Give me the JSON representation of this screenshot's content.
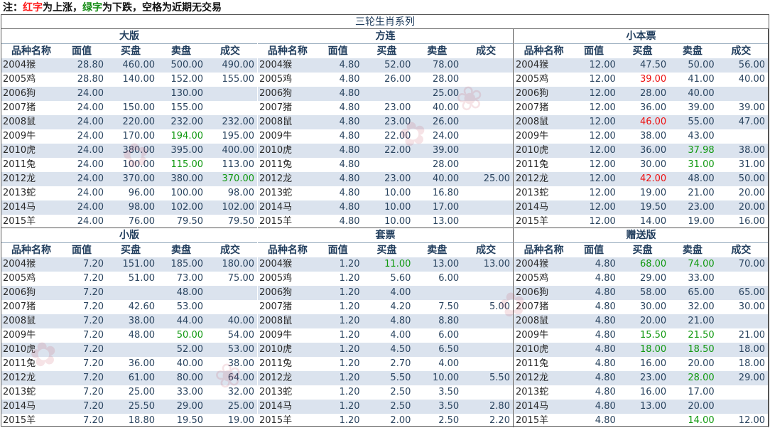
{
  "note": {
    "prefix": "注：",
    "red_label": "红字",
    "mid1": "为上涨，",
    "green_label": "绿字",
    "mid2": "为下跌，空格为近期无交易"
  },
  "main_title": "三轮生肖系列",
  "colors": {
    "up": "#ee1111",
    "down": "#119911",
    "header": "#1f3c5c",
    "row_alt": "#dbe3ee"
  },
  "columns": [
    "品种名称",
    "面值",
    "买盘",
    "卖盘",
    "成交"
  ],
  "panels": [
    {
      "title": "大版",
      "rows": [
        [
          "2004猴",
          "28.80",
          "460.00",
          "500.00",
          "490.00"
        ],
        [
          "2005鸡",
          "28.80",
          "140.00",
          "152.00",
          "155.00"
        ],
        [
          "2006狗",
          "24.00",
          "",
          "130.00",
          ""
        ],
        [
          "2007猪",
          "24.00",
          "150.00",
          "155.00",
          ""
        ],
        [
          "2008鼠",
          "24.00",
          "220.00",
          "232.00",
          "232.00"
        ],
        [
          "2009牛",
          "24.00",
          "170.00",
          "194.00",
          "195.00"
        ],
        [
          "2010虎",
          "24.00",
          "380.00",
          "395.00",
          "400.00"
        ],
        [
          "2011兔",
          "24.00",
          "100.00",
          "115.00",
          "113.00"
        ],
        [
          "2012龙",
          "24.00",
          "370.00",
          "380.00",
          "370.00"
        ],
        [
          "2013蛇",
          "24.00",
          "96.00",
          "100.00",
          "98.00"
        ],
        [
          "2014马",
          "24.00",
          "98.00",
          "102.00",
          "102.00"
        ],
        [
          "2015羊",
          "24.00",
          "76.00",
          "79.50",
          "79.50"
        ]
      ],
      "colors": [
        [
          5,
          3,
          "down"
        ],
        [
          7,
          3,
          "down"
        ],
        [
          8,
          4,
          "down"
        ]
      ]
    },
    {
      "title": "方连",
      "rows": [
        [
          "2004猴",
          "4.80",
          "52.00",
          "78.00",
          ""
        ],
        [
          "2005鸡",
          "4.80",
          "26.00",
          "28.00",
          ""
        ],
        [
          "2006狗",
          "4.80",
          "",
          "25.00",
          ""
        ],
        [
          "2007猪",
          "4.80",
          "23.00",
          "40.00",
          ""
        ],
        [
          "2008鼠",
          "4.80",
          "23.00",
          "26.00",
          ""
        ],
        [
          "2009牛",
          "4.80",
          "22.00",
          "24.00",
          ""
        ],
        [
          "2010虎",
          "4.80",
          "22.00",
          "39.00",
          ""
        ],
        [
          "2011兔",
          "4.80",
          "",
          "28.00",
          ""
        ],
        [
          "2012龙",
          "4.80",
          "23.00",
          "40.00",
          "25.00"
        ],
        [
          "2013蛇",
          "4.80",
          "10.00",
          "16.80",
          ""
        ],
        [
          "2014马",
          "4.80",
          "10.00",
          "17.00",
          ""
        ],
        [
          "2015羊",
          "4.80",
          "10.00",
          "13.00",
          ""
        ]
      ],
      "colors": []
    },
    {
      "title": "小本票",
      "rows": [
        [
          "2004猴",
          "12.00",
          "47.50",
          "50.00",
          "56.00"
        ],
        [
          "2005鸡",
          "12.00",
          "39.00",
          "41.00",
          "40.00"
        ],
        [
          "2006狗",
          "12.00",
          "28.00",
          "40.00",
          ""
        ],
        [
          "2007猪",
          "12.00",
          "36.00",
          "39.00",
          "39.00"
        ],
        [
          "2008鼠",
          "12.00",
          "46.00",
          "55.00",
          "47.00"
        ],
        [
          "2009牛",
          "12.00",
          "38.00",
          "43.00",
          ""
        ],
        [
          "2010虎",
          "12.00",
          "36.00",
          "37.98",
          "38.00"
        ],
        [
          "2011兔",
          "12.00",
          "30.00",
          "31.00",
          "31.00"
        ],
        [
          "2012龙",
          "12.00",
          "42.00",
          "48.00",
          "50.00"
        ],
        [
          "2013蛇",
          "12.00",
          "19.00",
          "21.00",
          "20.00"
        ],
        [
          "2014马",
          "12.00",
          "19.50",
          "23.00",
          "20.00"
        ],
        [
          "2015羊",
          "12.00",
          "14.00",
          "19.00",
          "16.00"
        ]
      ],
      "colors": [
        [
          1,
          2,
          "up"
        ],
        [
          4,
          2,
          "up"
        ],
        [
          6,
          3,
          "down"
        ],
        [
          7,
          3,
          "down"
        ],
        [
          8,
          2,
          "up"
        ]
      ]
    },
    {
      "title": "小版",
      "rows": [
        [
          "2004猴",
          "7.20",
          "151.00",
          "185.00",
          "180.00"
        ],
        [
          "2005鸡",
          "7.20",
          "51.00",
          "73.00",
          "75.00"
        ],
        [
          "2006狗",
          "7.20",
          "",
          "48.00",
          ""
        ],
        [
          "2007猪",
          "7.20",
          "42.60",
          "53.00",
          ""
        ],
        [
          "2008鼠",
          "7.20",
          "38.00",
          "44.00",
          "40.00"
        ],
        [
          "2009牛",
          "7.20",
          "48.00",
          "50.00",
          "54.00"
        ],
        [
          "2010虎",
          "7.20",
          "",
          "52.00",
          "53.00"
        ],
        [
          "2011兔",
          "7.20",
          "36.00",
          "40.00",
          "38.00"
        ],
        [
          "2012龙",
          "7.20",
          "61.00",
          "80.00",
          "64.00"
        ],
        [
          "2013蛇",
          "7.20",
          "25.00",
          "33.00",
          "32.00"
        ],
        [
          "2014马",
          "7.20",
          "25.50",
          "29.00",
          "25.00"
        ],
        [
          "2015羊",
          "7.20",
          "18.80",
          "19.50",
          "19.00"
        ]
      ],
      "colors": [
        [
          5,
          3,
          "down"
        ]
      ]
    },
    {
      "title": "套票",
      "rows": [
        [
          "2004猴",
          "1.20",
          "11.00",
          "13.00",
          "13.00"
        ],
        [
          "2005鸡",
          "1.20",
          "5.60",
          "6.00",
          ""
        ],
        [
          "2006狗",
          "1.20",
          "4.00",
          "",
          ""
        ],
        [
          "2007猪",
          "1.20",
          "4.20",
          "7.50",
          "5.00"
        ],
        [
          "2008鼠",
          "1.20",
          "4.80",
          "8.80",
          ""
        ],
        [
          "2009牛",
          "1.20",
          "4.00",
          "6.00",
          ""
        ],
        [
          "2010虎",
          "1.20",
          "4.50",
          "6.50",
          ""
        ],
        [
          "2011兔",
          "1.20",
          "2.70",
          "4.00",
          ""
        ],
        [
          "2012龙",
          "1.20",
          "5.50",
          "10.00",
          "5.50"
        ],
        [
          "2013蛇",
          "1.20",
          "2.50",
          "3.50",
          ""
        ],
        [
          "2014马",
          "1.20",
          "2.50",
          "3.50",
          "2.80"
        ],
        [
          "2015羊",
          "1.20",
          "2.00",
          "2.50",
          "2.20"
        ]
      ],
      "colors": [
        [
          0,
          2,
          "down"
        ]
      ]
    },
    {
      "title": "赠送版",
      "rows": [
        [
          "2004猴",
          "4.80",
          "68.00",
          "74.00",
          "70.00"
        ],
        [
          "2005鸡",
          "4.80",
          "29.00",
          "33.00",
          ""
        ],
        [
          "2006狗",
          "4.80",
          "58.00",
          "65.00",
          "65.00"
        ],
        [
          "2007猪",
          "4.80",
          "30.00",
          "32.00",
          "30.00"
        ],
        [
          "2008鼠",
          "4.80",
          "20.00",
          "21.00",
          ""
        ],
        [
          "2009牛",
          "4.80",
          "15.50",
          "21.50",
          "21.00"
        ],
        [
          "2010虎",
          "4.80",
          "18.00",
          "18.50",
          "18.00"
        ],
        [
          "2011兔",
          "4.80",
          "16.00",
          "20.00",
          "18.00"
        ],
        [
          "2012龙",
          "4.80",
          "23.00",
          "28.00",
          "29.00"
        ],
        [
          "2013蛇",
          "4.80",
          "16.00",
          "17.00",
          ""
        ],
        [
          "2014马",
          "4.80",
          "13.00",
          "20.00",
          ""
        ],
        [
          "2015羊",
          "4.80",
          "",
          "14.00",
          "12.00"
        ]
      ],
      "colors": [
        [
          0,
          2,
          "down"
        ],
        [
          0,
          3,
          "down"
        ],
        [
          5,
          2,
          "down"
        ],
        [
          5,
          3,
          "down"
        ],
        [
          6,
          2,
          "down"
        ],
        [
          6,
          3,
          "down"
        ],
        [
          8,
          3,
          "down"
        ],
        [
          11,
          3,
          "down"
        ]
      ]
    }
  ]
}
